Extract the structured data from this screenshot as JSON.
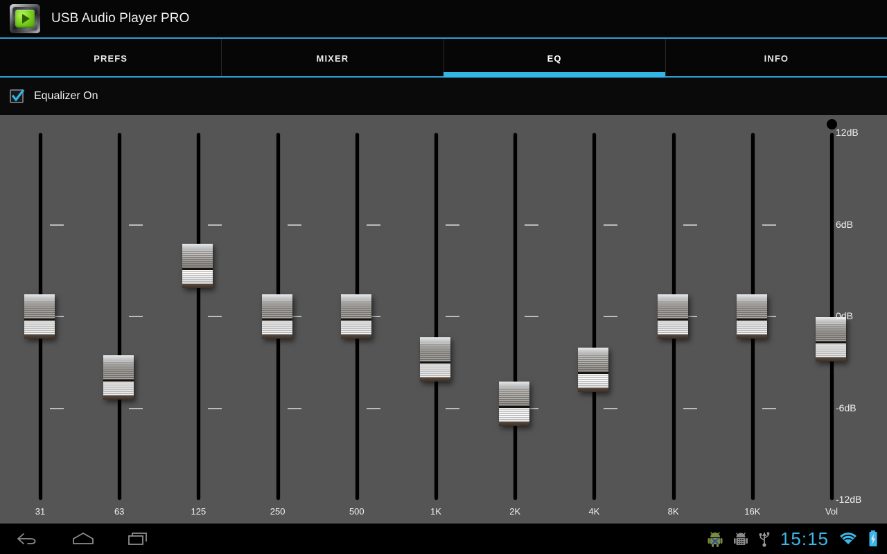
{
  "titlebar": {
    "app_name": "USB Audio Player PRO",
    "icon": "app-play-icon",
    "accent_color": "#2f9fd4"
  },
  "tabs": [
    {
      "label": "PREFS",
      "active": false
    },
    {
      "label": "MIXER",
      "active": false
    },
    {
      "label": "EQ",
      "active": true
    },
    {
      "label": "INFO",
      "active": false
    }
  ],
  "tabs_meta": {
    "active_index": 2,
    "active_color": "#33b5e5"
  },
  "equalizer_toggle": {
    "label": "Equalizer On",
    "checked": true,
    "check_color": "#33b5e5"
  },
  "eq": {
    "db_labels": [
      "12dB",
      "6dB",
      "0dB",
      "-6dB",
      "-12dB"
    ],
    "range_min_db": -12,
    "range_max_db": 12,
    "tick_db": [
      6,
      0,
      -6
    ],
    "bands": [
      {
        "label": "31",
        "value_db": 0.0
      },
      {
        "label": "63",
        "value_db": -4.0
      },
      {
        "label": "125",
        "value_db": 3.3
      },
      {
        "label": "250",
        "value_db": 0.0
      },
      {
        "label": "500",
        "value_db": 0.0
      },
      {
        "label": "1K",
        "value_db": -2.8
      },
      {
        "label": "2K",
        "value_db": -5.7
      },
      {
        "label": "4K",
        "value_db": -3.5
      },
      {
        "label": "8K",
        "value_db": 0.0
      },
      {
        "label": "16K",
        "value_db": 0.0
      },
      {
        "label": "Vol",
        "value_db": -1.5
      }
    ]
  },
  "navbar": {
    "back": "back-icon",
    "home": "home-icon",
    "recents": "recents-icon"
  },
  "statusbar": {
    "time": "15:15",
    "time_color": "#3cb6e8",
    "icons": [
      "android-robot-icon",
      "adb-debug-icon",
      "usb-icon",
      "wifi-icon",
      "battery-charging-icon"
    ]
  }
}
